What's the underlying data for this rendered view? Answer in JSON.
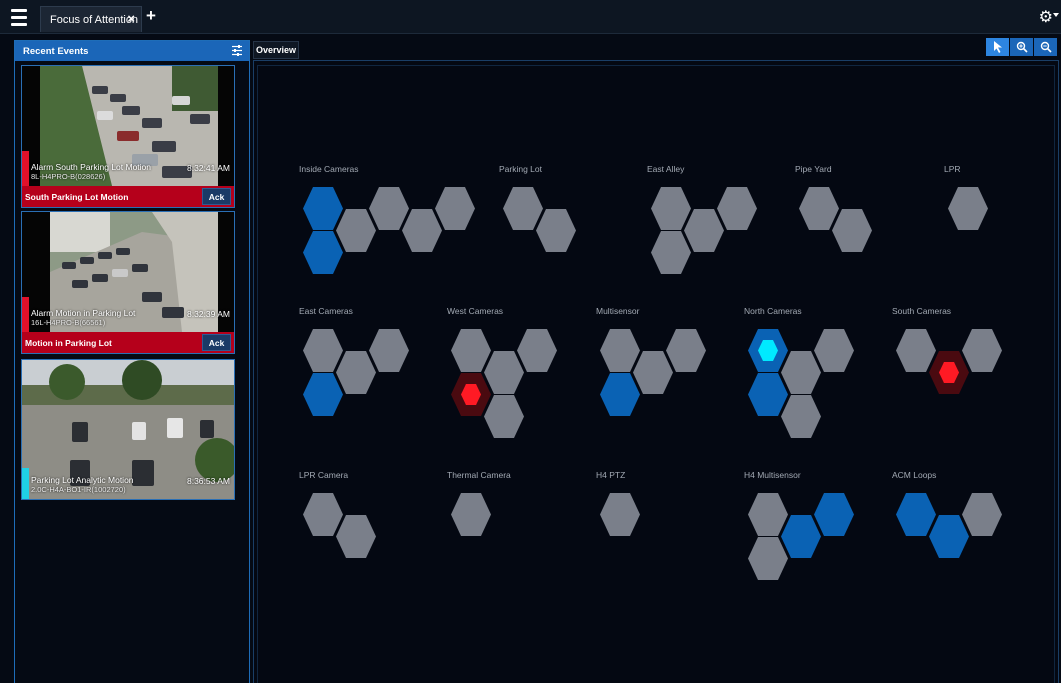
{
  "tab": {
    "title": "Focus of Attention",
    "close": "×",
    "add": "+"
  },
  "settings_icon": "⚙",
  "left": {
    "header": "Recent Events",
    "events": [
      {
        "title": "Alarm South Parking Lot Motion",
        "camera": "8L-H4PRO-B(028626)",
        "time": "8:32:41 AM",
        "footer": "South Parking Lot Motion",
        "ack": "Ack",
        "bar_color": "#e0112a"
      },
      {
        "title": "Alarm Motion in Parking Lot",
        "camera": "16L-H4PRO-B(66561)",
        "time": "8:32:39 AM",
        "footer": "Motion in Parking Lot",
        "ack": "Ack",
        "bar_color": "#e0112a"
      },
      {
        "title": "Parking Lot Analytic Motion",
        "camera": "2.0C-H4A-BO1-IR(1002720)",
        "time": "8:36:53 AM",
        "bar_color": "#1fd1e6"
      }
    ]
  },
  "main": {
    "tab": "Overview",
    "groups": [
      {
        "label": "Inside Cameras"
      },
      {
        "label": "Parking Lot"
      },
      {
        "label": "East Alley"
      },
      {
        "label": "Pipe Yard"
      },
      {
        "label": "LPR"
      },
      {
        "label": "East Cameras"
      },
      {
        "label": "West Cameras"
      },
      {
        "label": "Multisensor"
      },
      {
        "label": "North Cameras"
      },
      {
        "label": "South Cameras"
      },
      {
        "label": "LPR Camera"
      },
      {
        "label": "Thermal Camera"
      },
      {
        "label": "H4 PTZ"
      },
      {
        "label": "H4 Multisensor"
      },
      {
        "label": "ACM Loops"
      }
    ]
  },
  "colors": {
    "accent": "#1b66b8",
    "alarm": "#ff1a24",
    "gray_hex": "#7a7f8a",
    "blue_hex": "#0a62b4",
    "active": "#00eaff"
  }
}
